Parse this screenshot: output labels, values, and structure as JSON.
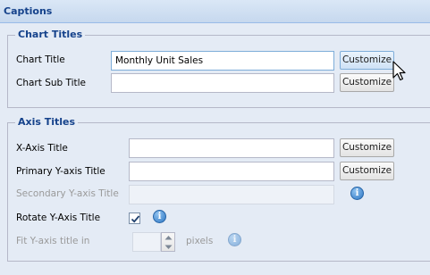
{
  "panel": {
    "title": "Captions"
  },
  "chart_titles": {
    "legend": "Chart Titles",
    "chart_title_label": "Chart Title",
    "chart_title_value": "Monthly Unit Sales",
    "chart_subtitle_label": "Chart Sub Title",
    "chart_subtitle_value": "",
    "customize_label": "Customize"
  },
  "axis_titles": {
    "legend": "Axis Titles",
    "x_axis_label": "X-Axis Title",
    "x_axis_value": "",
    "primary_y_label": "Primary Y-axis Title",
    "primary_y_value": "",
    "secondary_y_label": "Secondary Y-axis Title",
    "secondary_y_value": "",
    "rotate_y_label": "Rotate Y-Axis Title",
    "rotate_y_checked": true,
    "fit_y_label": "Fit Y-axis title in",
    "fit_y_value": "",
    "fit_y_unit": "pixels",
    "customize_label": "Customize"
  },
  "icons": {
    "info": "info-icon",
    "check": "check-icon",
    "cursor": "mouse-pointer-icon"
  }
}
